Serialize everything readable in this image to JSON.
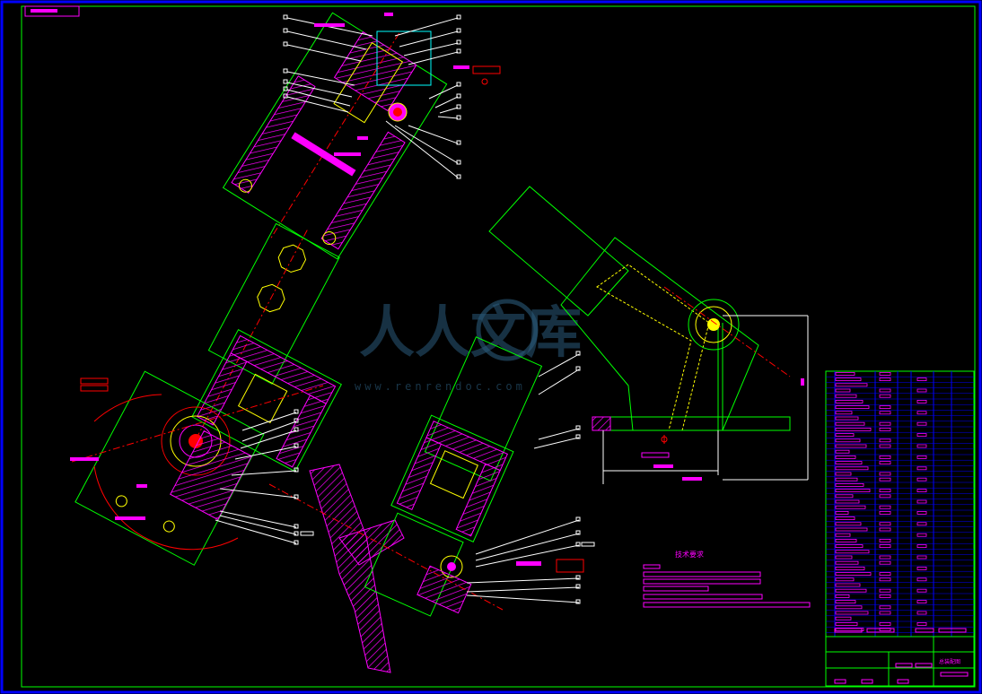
{
  "tech_requirements": {
    "title": "技术要求"
  },
  "title_block": {
    "drawing_name": "总装配图"
  },
  "watermark": {
    "brand": "人人文库",
    "url": "www.renrendoc.com"
  },
  "colors": {
    "background": "#000000",
    "frame": "#00ff00",
    "outline": "#00ff00",
    "hatch": "#ff00ff",
    "centerline": "#ff0000",
    "leader": "#ffffff",
    "hidden": "#ffff00",
    "dimension": "#ff00ff",
    "aux": "#0000ff"
  }
}
